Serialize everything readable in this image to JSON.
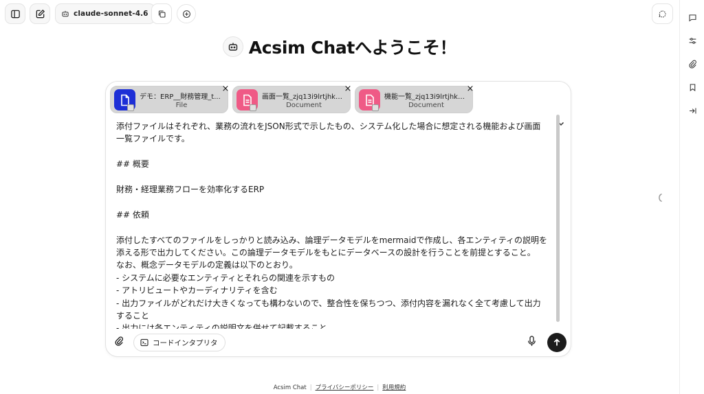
{
  "topbar": {
    "model_label": "claude-sonnet-4.6",
    "icons": [
      "sidebar-toggle-icon",
      "new-chat-icon",
      "bot-icon",
      "copy-icon",
      "add-circle-icon",
      "temporary-chat-icon"
    ]
  },
  "welcome": {
    "title": "Acsim Chatへようこそ！",
    "icon": "bot-icon"
  },
  "right_rail": {
    "icons": [
      "chat-icon",
      "sliders-icon",
      "paperclip-icon",
      "bookmark-icon",
      "collapse-panel-icon"
    ]
  },
  "attachments": [
    {
      "name": "デモ：ERP__財務管理_t...",
      "type": "File",
      "color": "#1d2fd6"
    },
    {
      "name": "画面一覧_zjq13i9lrtjhkp...",
      "type": "Document",
      "color": "#ef5a86"
    },
    {
      "name": "機能一覧_zjq13i9lrtjhkp...",
      "type": "Document",
      "color": "#ef5a86"
    }
  ],
  "message": {
    "lines": [
      "添付ファイルはそれぞれ、業務の流れをJSON形式で示したもの、システム化した場合に想定される機能および画面",
      "一覧ファイルです。",
      "",
      "## 概要",
      "",
      "財務・経理業務フローを効率化するERP",
      "",
      "## 依頼",
      "",
      "添付したすべてのファイルをしっかりと読み込み、論理データモデルをmermaidで作成し、各エンティティの説明を",
      "添える形で出力してください。この論理データモデルをもとにデータベースの設計を行うことを前提とすること。",
      "なお、概念データモデルの定義は以下のとおり。",
      "- システムに必要なエンティティとそれらの関連を示すもの",
      "- アトリビュートやカーディナリティを含む",
      "- 出力ファイルがどれだけ大きくなっても構わないので、整合性を保ちつつ、添付内容を漏れなく全て考慮して出力",
      "すること",
      "- 出力には各エンティティの説明文を併せて記載すること"
    ]
  },
  "composer": {
    "code_interpreter_label": "コードインタプリタ"
  },
  "footer": {
    "brand": "Acsim Chat",
    "privacy": "プライバシーポリシー",
    "terms": "利用規約"
  },
  "colors": {
    "send_button": "#1c1c1c",
    "file_card_bg": "#d6d6d6"
  }
}
